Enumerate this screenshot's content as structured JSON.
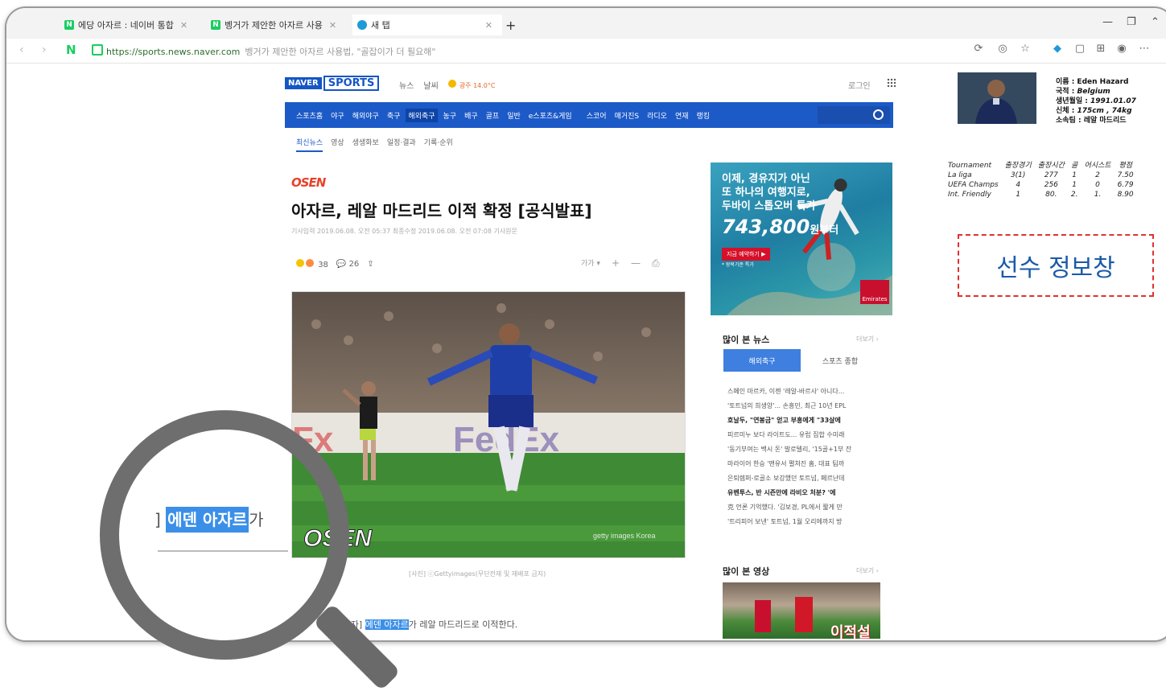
{
  "browser": {
    "tabs": [
      {
        "label": "에당 아자르 : 네이버 통합"
      },
      {
        "label": "벵거가 제안한 아자르 사용"
      },
      {
        "label": "새 탭"
      }
    ],
    "new_tab": "+",
    "url": "https://sports.news.naver.com",
    "page_title": "벵거가 제안한 아자르 사용법, \"골잡이가 더 필요해\""
  },
  "site": {
    "logo_naver": "NAVER",
    "logo_sports": "SPORTS",
    "header_links": [
      "뉴스",
      "날씨"
    ],
    "weather": "광주 14.0°C",
    "login": "로그인",
    "nav_items": [
      "스포츠홈",
      "야구",
      "해외야구",
      "축구",
      "해외축구",
      "농구",
      "배구",
      "골프",
      "일반",
      "e스포츠&게임",
      "스코어",
      "매거진S",
      "라디오",
      "연재",
      "랭킹"
    ],
    "nav_selected": "해외축구",
    "sub_nav": [
      "최신뉴스",
      "영상",
      "생생화보",
      "일정·결과",
      "기록·순위"
    ]
  },
  "article": {
    "source_logo": "OSEN",
    "headline": "아자르, 레알 마드리드 이적 확정 [공식발표]",
    "meta": "기사입력 2019.06.08. 오전 05:37    최종수정 2019.06.08. 오전 07:08    기사원문",
    "reaction_count": "38",
    "comment_count": "26",
    "caption": "[사진] ⓒGettyimages(무단전재 및 재배포 금지)",
    "body_prefix": "원 기자] ",
    "body_highlight": "에덴 아자르",
    "body_suffix": "가 레알 마드리드로 이적한다.",
    "photo_watermark": "OSEN",
    "photo_credit": "getty images Korea"
  },
  "ad": {
    "line1": "이제, 경유지가 아닌",
    "line2": "또 하나의 여행지로,",
    "line3": "두바이 스톱오버 특가",
    "price": "743,800",
    "price_unit": "원부터",
    "button": "지금 예약하기 ▶",
    "note": "* 왕복기준 특가",
    "brand": "Emirates"
  },
  "most_viewed": {
    "title": "많이 본 뉴스",
    "more": "더보기 ›",
    "tabs": [
      "해외축구",
      "스포츠 종합"
    ],
    "items": [
      {
        "text": "스페인 마르카, 이젠 '레알-바르사' 아니다...",
        "bold": false
      },
      {
        "text": "'토트넘의 희생양'... 손흥민, 최근 10년 EPL",
        "bold": false
      },
      {
        "text": "호날두, \"연봉금\" 얻고 부흥에게 \"33살에",
        "bold": true
      },
      {
        "text": "피르미누 보다 라이트도... 유럽 집합 수미래",
        "bold": false
      },
      {
        "text": "'동기부여는 백시 돈' 발로텔리, '15골+1부 잔",
        "bold": false
      },
      {
        "text": "마라이어 한승 '맨유서 펼쳐진 홈, 대표 팀까",
        "bold": false
      },
      {
        "text": "은퇴렙퍼-로골소 보강했던 토트넘, 페르난데",
        "bold": false
      },
      {
        "text": "유벤투스, 반 시즌만에 라비오 처분? '에",
        "bold": true
      },
      {
        "text": "克 언론 기억했다. '김보경, PL에서 짧게 만",
        "bold": false
      },
      {
        "text": "'트리피어 보낸' 토트넘, 1월 오리에까지 방",
        "bold": false
      }
    ]
  },
  "most_viewed_video": {
    "title": "많이 본 영상",
    "more": "더보기 ›",
    "thumb_text": "이적설"
  },
  "player": {
    "name": "이름 : Eden Hazard",
    "nation_label": "국적 : ",
    "nation": "Belgium",
    "birth_label": "생년월일 : ",
    "birth": "1991.01.07",
    "body_label": "신체 : ",
    "body": "175cm , 74kg",
    "club": "소속팀 : 레알 마드리드",
    "stats_headers": [
      "Tournament",
      "출장경기",
      "출장시간",
      "골",
      "어시스트",
      "평점"
    ],
    "stats_rows": [
      [
        "La liga",
        "3(1)",
        "277",
        "1",
        "2",
        "7.50"
      ],
      [
        "UEFA Champs",
        "4",
        "256",
        "1",
        "0",
        "6.79"
      ],
      [
        "Int. Friendly",
        "1",
        "80.",
        "2.",
        "1.",
        "8.90"
      ]
    ],
    "panel_label": "선수 정보창"
  },
  "zoom": {
    "bracket": "]",
    "highlight": "에덴 아자르",
    "suffix": "가"
  }
}
